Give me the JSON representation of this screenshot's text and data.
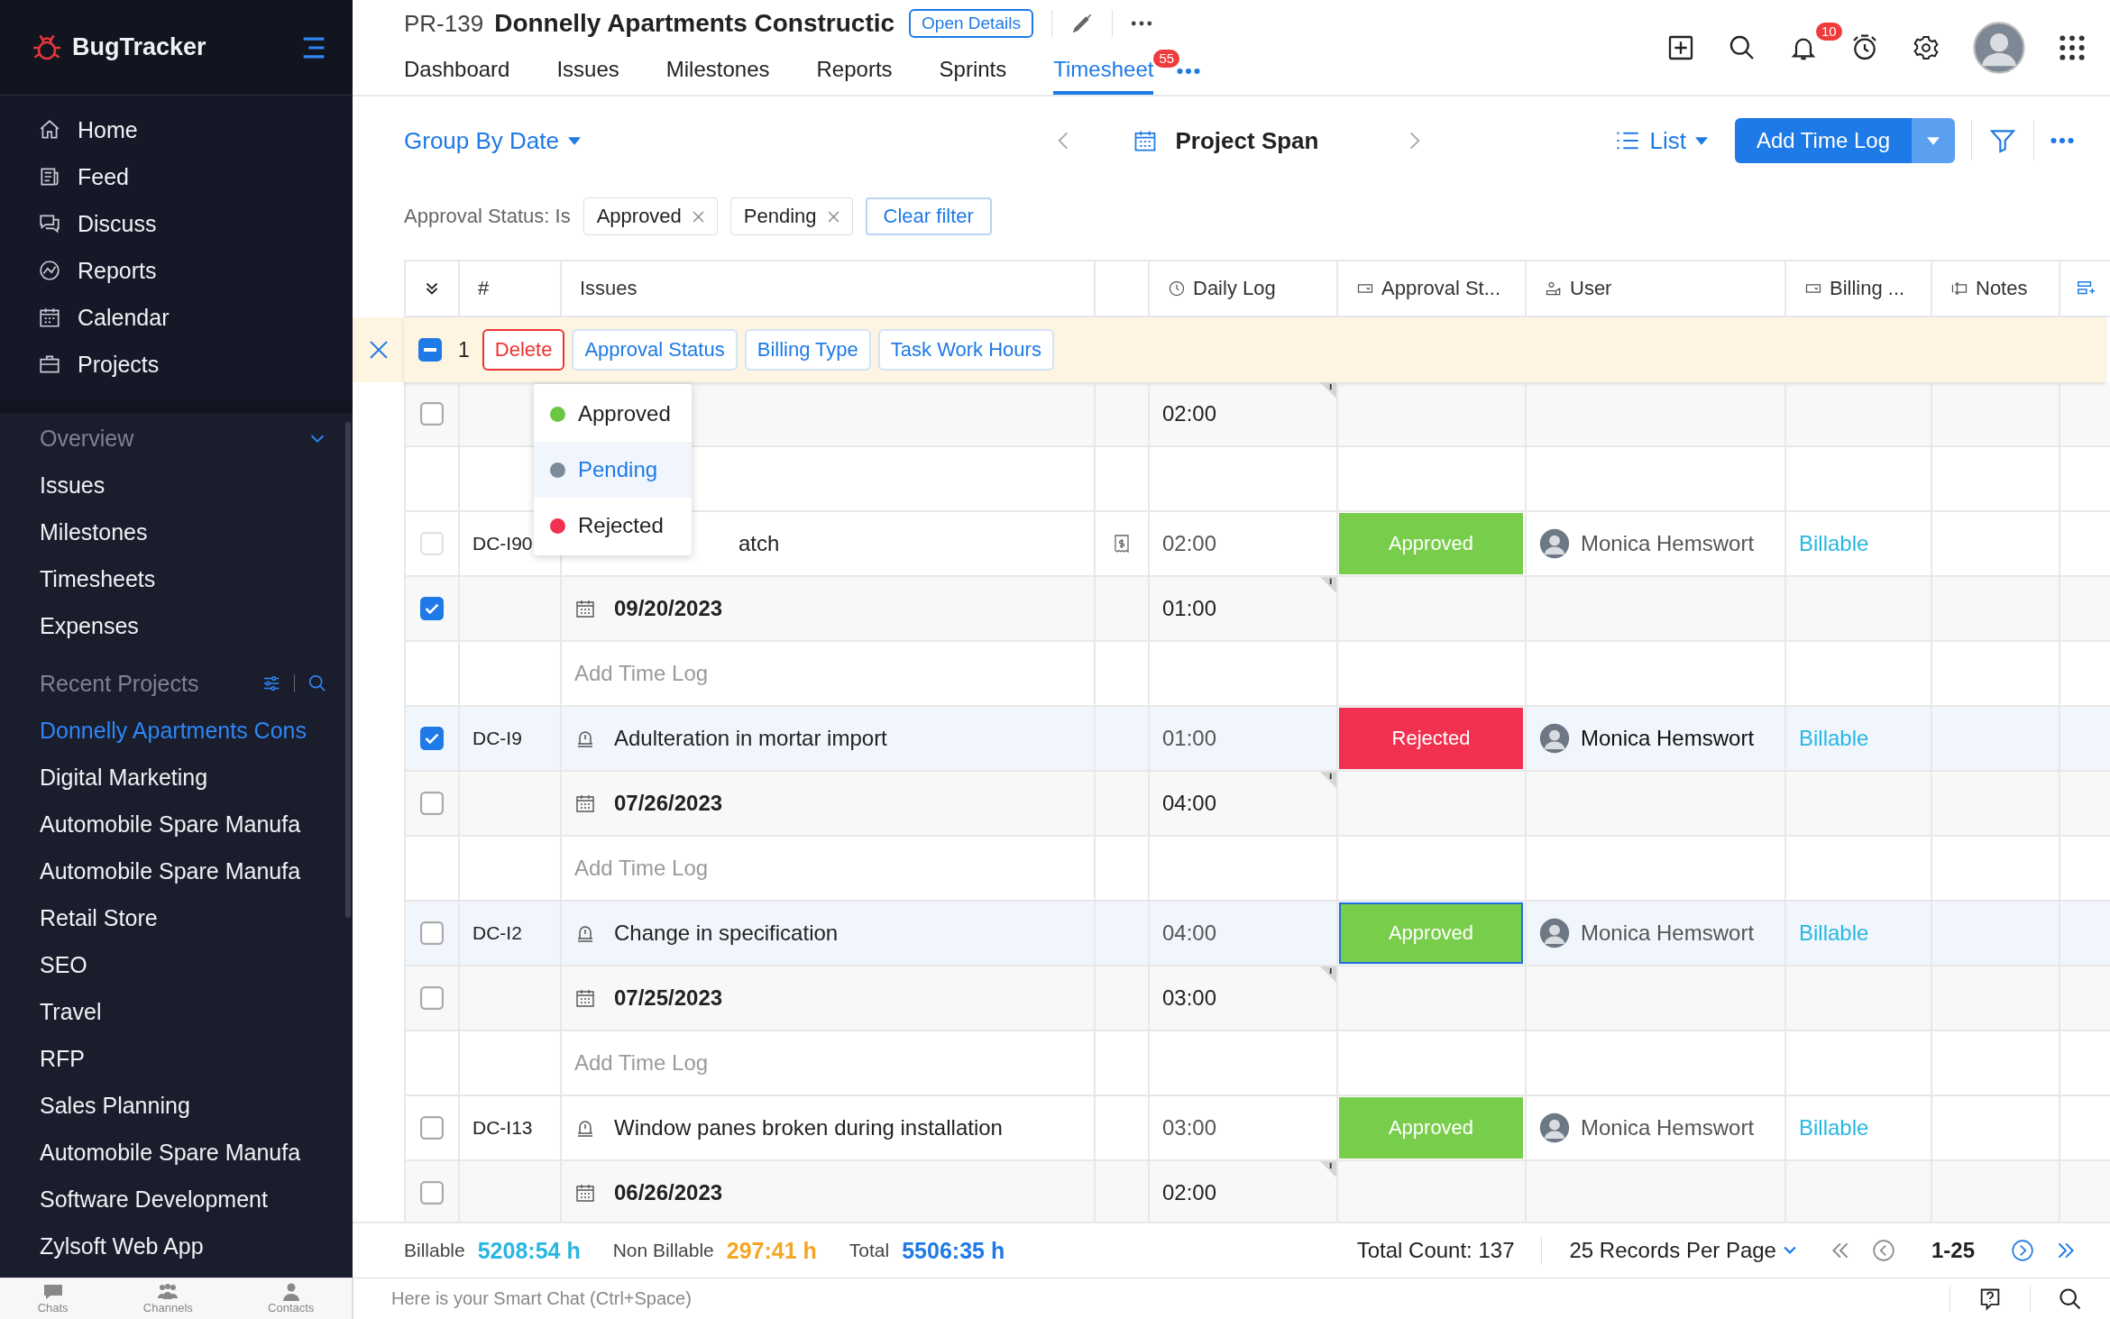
{
  "sidebar": {
    "brand": "BugTracker",
    "nav": [
      {
        "label": "Home"
      },
      {
        "label": "Feed"
      },
      {
        "label": "Discuss"
      },
      {
        "label": "Reports"
      },
      {
        "label": "Calendar"
      },
      {
        "label": "Projects"
      }
    ],
    "overview": {
      "title": "Overview",
      "expanded": true,
      "items": [
        {
          "label": "Issues"
        },
        {
          "label": "Milestones"
        },
        {
          "label": "Timesheets"
        },
        {
          "label": "Expenses"
        }
      ]
    },
    "recent": {
      "title": "Recent Projects",
      "projects": [
        {
          "label": "Donnelly Apartments Cons",
          "selected": true
        },
        {
          "label": "Digital Marketing",
          "selected": false
        },
        {
          "label": "Automobile Spare Manufa",
          "selected": false
        },
        {
          "label": "Automobile Spare Manufa",
          "selected": false
        },
        {
          "label": "Retail Store",
          "selected": false
        },
        {
          "label": "SEO",
          "selected": false
        },
        {
          "label": "Travel",
          "selected": false
        },
        {
          "label": "RFP",
          "selected": false
        },
        {
          "label": "Sales Planning",
          "selected": false
        },
        {
          "label": "Automobile Spare Manufa",
          "selected": false
        },
        {
          "label": "Software Development",
          "selected": false
        },
        {
          "label": "Zylsoft Web App",
          "selected": false
        }
      ]
    }
  },
  "header": {
    "code": "PR-139",
    "title": "Donnelly Apartments Constructic",
    "open_details": "Open Details",
    "tabs": [
      {
        "label": "Dashboard",
        "selected": false
      },
      {
        "label": "Issues",
        "selected": false
      },
      {
        "label": "Milestones",
        "selected": false
      },
      {
        "label": "Reports",
        "selected": false
      },
      {
        "label": "Sprints",
        "selected": false
      },
      {
        "label": "Timesheet",
        "selected": true,
        "badge": "55"
      }
    ],
    "notifications": "10"
  },
  "toolbar": {
    "group_by": "Group By Date",
    "period": "Project Span",
    "view": "List",
    "add": "Add Time Log"
  },
  "filter": {
    "label": "Approval Status: Is",
    "chips": [
      "Approved",
      "Pending"
    ],
    "clear": "Clear filter"
  },
  "table": {
    "columns": [
      {
        "label": "#",
        "kind": "plain"
      },
      {
        "label": "Issues",
        "kind": "plain"
      },
      {
        "label": "Daily Log",
        "kind": "time"
      },
      {
        "label": "Approval St...",
        "kind": "picklist"
      },
      {
        "label": "User",
        "kind": "user"
      },
      {
        "label": "Billing ...",
        "kind": "picklist"
      },
      {
        "label": "Notes",
        "kind": "text"
      }
    ],
    "selection": {
      "checked": false,
      "indeterminate": true,
      "count": "1",
      "actions": [
        {
          "label": "Delete",
          "kind": "danger"
        },
        {
          "label": "Approval Status",
          "kind": "normal"
        },
        {
          "label": "Billing Type",
          "kind": "normal"
        },
        {
          "label": "Task Work Hours",
          "kind": "normal"
        }
      ]
    },
    "rows": [
      {
        "kind": "date",
        "checked": false,
        "disabled": false,
        "daily_log": "02:00"
      },
      {
        "kind": "add"
      },
      {
        "kind": "issue",
        "checked": false,
        "disabled": true,
        "highlighted": false,
        "id": "DC-I90",
        "title": "atch",
        "obscured": true,
        "receipt": true,
        "daily_log": "02:00",
        "approval": {
          "label": "Approved",
          "color": "#78cd4a",
          "focused": false
        },
        "user": "Monica Hemswort",
        "billing": "Billable"
      },
      {
        "kind": "date",
        "checked": true,
        "disabled": false,
        "date": "09/20/2023",
        "daily_log": "01:00"
      },
      {
        "kind": "add",
        "label": "Add Time Log"
      },
      {
        "kind": "issue",
        "checked": true,
        "disabled": false,
        "highlighted": true,
        "id": "DC-I9",
        "title": "Adulteration in mortar import",
        "obscured": false,
        "receipt": false,
        "daily_log": "01:00",
        "approval": {
          "label": "Rejected",
          "color": "#f2304f",
          "focused": false
        },
        "user": "Monica Hemswort",
        "billing": "Billable"
      },
      {
        "kind": "date",
        "checked": false,
        "disabled": false,
        "date": "07/26/2023",
        "daily_log": "04:00"
      },
      {
        "kind": "add",
        "label": "Add Time Log"
      },
      {
        "kind": "issue",
        "checked": false,
        "disabled": false,
        "highlighted": true,
        "id": "DC-I2",
        "title": "Change in specification",
        "obscured": false,
        "receipt": false,
        "daily_log": "04:00",
        "approval": {
          "label": "Approved",
          "color": "#78cd4a",
          "focused": true
        },
        "user": "Monica Hemswort",
        "billing": "Billable"
      },
      {
        "kind": "date",
        "checked": false,
        "disabled": false,
        "date": "07/25/2023",
        "daily_log": "03:00"
      },
      {
        "kind": "add",
        "label": "Add Time Log"
      },
      {
        "kind": "issue",
        "checked": false,
        "disabled": false,
        "highlighted": false,
        "id": "DC-I13",
        "title": "Window panes broken during installation",
        "obscured": false,
        "receipt": false,
        "daily_log": "03:00",
        "approval": {
          "label": "Approved",
          "color": "#78cd4a",
          "focused": false
        },
        "user": "Monica Hemswort",
        "billing": "Billable"
      },
      {
        "kind": "date",
        "checked": false,
        "disabled": false,
        "date": "06/26/2023",
        "daily_log": "02:00"
      }
    ]
  },
  "status_menu": {
    "options": [
      {
        "label": "Approved",
        "color": "#6cc644",
        "selected": false
      },
      {
        "label": "Pending",
        "color": "#7a8c99",
        "selected": true
      },
      {
        "label": "Rejected",
        "color": "#f2304f",
        "selected": false
      }
    ]
  },
  "footer": {
    "totals": [
      {
        "label": "Billable",
        "value": "5208:54 h",
        "color": "#29b6e0"
      },
      {
        "label": "Non Billable",
        "value": "297:41 h",
        "color": "#f5a623"
      },
      {
        "label": "Total",
        "value": "5506:35 h",
        "color": "#1e7ae6"
      }
    ],
    "count": "Total Count: 137",
    "per_page": "25 Records Per Page",
    "range": "1-25"
  },
  "bottom_bar": {
    "apps": [
      "Chats",
      "Channels",
      "Contacts"
    ],
    "chat_placeholder": "Here is your Smart Chat (Ctrl+Space)"
  }
}
